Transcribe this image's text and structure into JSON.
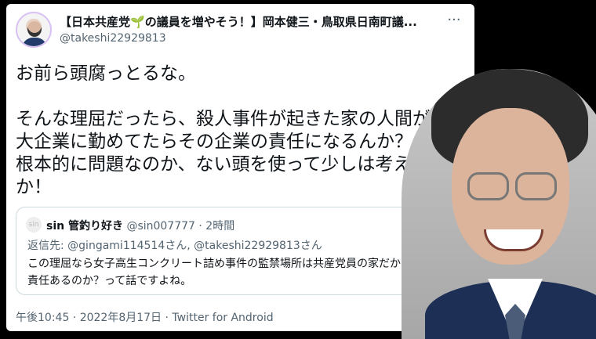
{
  "tweet": {
    "display_name_prefix": "【日本共産党",
    "display_name_sprout": "🌱",
    "display_name_suffix": "の議員を増やそう！】岡本健三・鳥取県日南町議...",
    "handle": "@takeshi22929813",
    "text": "お前ら頭腐っとるな。\n\nそんな理屈だったら、殺人事件が起きた家の人間が実は\n大企業に勤めてたらその企業の責任になるんか？何が\n根本的に問題なのか、ない頭を使って少しは考えんか\nか！",
    "quote": {
      "avatar_text": "sin",
      "name": "sin 管釣り好き",
      "handle": "@sin007777",
      "time": "· 2時間",
      "reply_label": "返信先:",
      "reply_users": "@gingami114514さん, @takeshi22929813さん",
      "text": "この理屈なら女子高生コンクリート詰め事件の監禁場所は共産党員の家だから、共産党に責任あるのか？って話ですよね。"
    },
    "footer": "午後10:45 · 2022年8月17日 · Twitter for Android"
  }
}
